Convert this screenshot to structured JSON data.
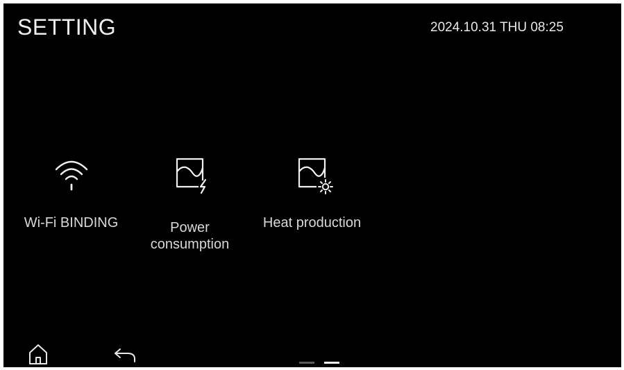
{
  "header": {
    "title": "SETTING",
    "datetime": "2024.10.31 THU 08:25"
  },
  "menu": {
    "items": [
      {
        "label": "Wi-Fi BINDING",
        "icon": "wifi-icon"
      },
      {
        "label_line1": "Power",
        "label_line2": "consumption",
        "icon": "power-consumption-icon"
      },
      {
        "label": "Heat production",
        "icon": "heat-production-icon"
      }
    ]
  },
  "navigation": {
    "home_icon": "home-icon",
    "back_icon": "back-arrow-icon"
  },
  "pager": {
    "page_count": 2,
    "active_page": 2
  },
  "colors": {
    "background": "#000000",
    "text": "#e9e9e9",
    "pager_inactive": "#5a5a5a",
    "pager_active": "#f2f2f2"
  }
}
